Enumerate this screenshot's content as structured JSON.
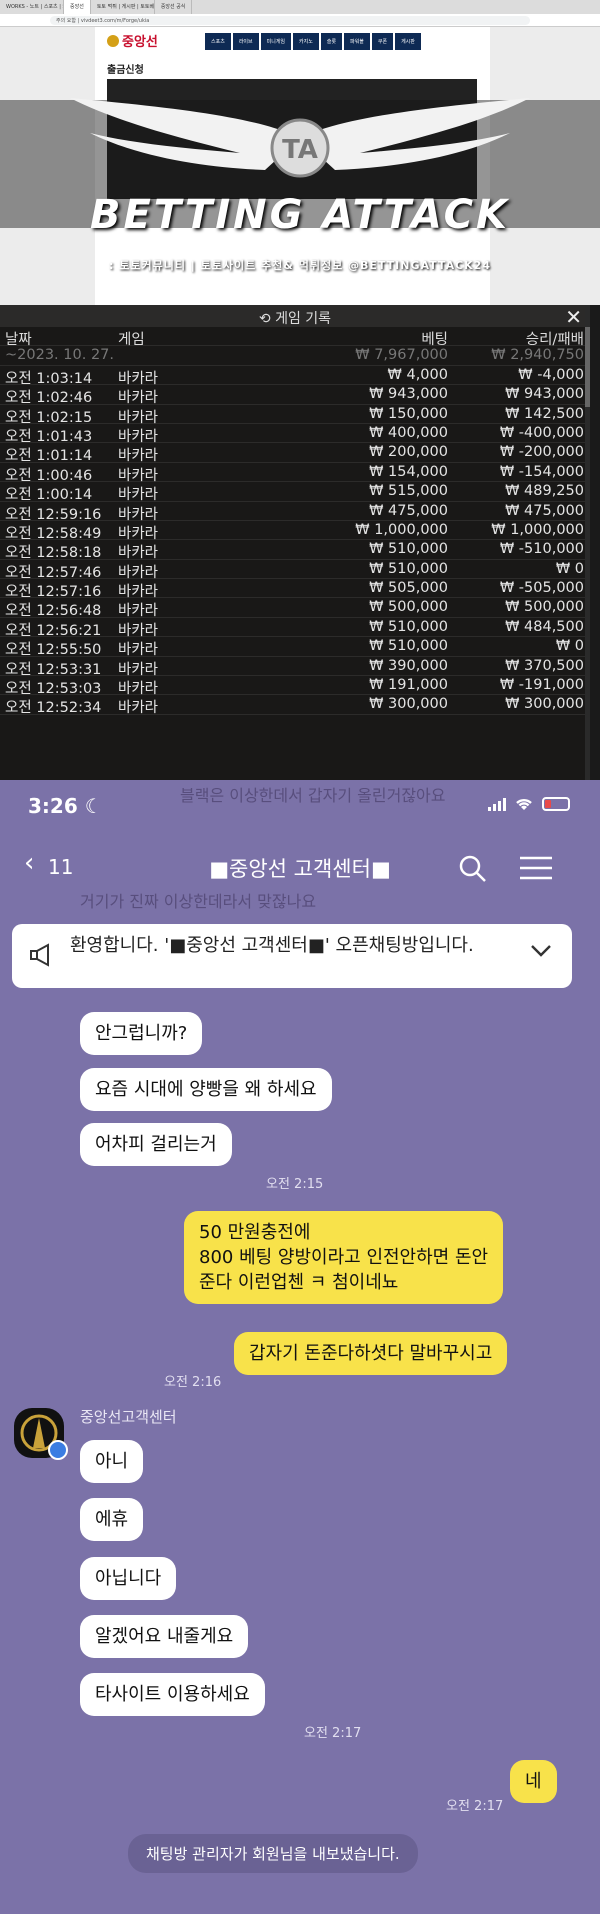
{
  "browser": {
    "tabs": [
      "WORKS - 노트 | 스포츠 | SMALL",
      "중앙선",
      "토토 먹튀 | 게시판 | 토토베팅",
      "중앙선 공식"
    ],
    "url": "주의 요함 | vivdeet3.com/m/Forge/ukia"
  },
  "site": {
    "logo": "중앙선",
    "nav": [
      "스포츠",
      "라이브",
      "미니게임",
      "카지노",
      "슬롯",
      "파워볼",
      "쿠폰",
      "게시판"
    ],
    "page_title": "출금신청"
  },
  "watermark": {
    "badge": "TA",
    "title": "BETTING ATTACK",
    "subtitle": ": 토토커뮤니티 | 토토사이트 추천& 먹튀정보 @BETTINGATTACK24"
  },
  "game_history": {
    "title": "게임 기록",
    "columns": [
      "날짜",
      "게임",
      "베팅",
      "승리/패배"
    ],
    "summary": {
      "date": "~2023. 10. 27.",
      "bet": "₩ 7,967,000",
      "win": "₩ 2,940,750"
    },
    "rows": [
      {
        "time": "오전 1:03:14",
        "game": "바카라",
        "bet": "₩ 4,000",
        "win": "₩ -4,000"
      },
      {
        "time": "오전 1:02:46",
        "game": "바카라",
        "bet": "₩ 943,000",
        "win": "₩ 943,000"
      },
      {
        "time": "오전 1:02:15",
        "game": "바카라",
        "bet": "₩ 150,000",
        "win": "₩ 142,500"
      },
      {
        "time": "오전 1:01:43",
        "game": "바카라",
        "bet": "₩ 400,000",
        "win": "₩ -400,000"
      },
      {
        "time": "오전 1:01:14",
        "game": "바카라",
        "bet": "₩ 200,000",
        "win": "₩ -200,000"
      },
      {
        "time": "오전 1:00:46",
        "game": "바카라",
        "bet": "₩ 154,000",
        "win": "₩ -154,000"
      },
      {
        "time": "오전 1:00:14",
        "game": "바카라",
        "bet": "₩ 515,000",
        "win": "₩ 489,250"
      },
      {
        "time": "오전 12:59:16",
        "game": "바카라",
        "bet": "₩ 475,000",
        "win": "₩ 475,000"
      },
      {
        "time": "오전 12:58:49",
        "game": "바카라",
        "bet": "₩ 1,000,000",
        "win": "₩ 1,000,000"
      },
      {
        "time": "오전 12:58:18",
        "game": "바카라",
        "bet": "₩ 510,000",
        "win": "₩ -510,000"
      },
      {
        "time": "오전 12:57:46",
        "game": "바카라",
        "bet": "₩ 510,000",
        "win": "₩ 0"
      },
      {
        "time": "오전 12:57:16",
        "game": "바카라",
        "bet": "₩ 505,000",
        "win": "₩ -505,000"
      },
      {
        "time": "오전 12:56:48",
        "game": "바카라",
        "bet": "₩ 500,000",
        "win": "₩ 500,000"
      },
      {
        "time": "오전 12:56:21",
        "game": "바카라",
        "bet": "₩ 510,000",
        "win": "₩ 484,500"
      },
      {
        "time": "오전 12:55:50",
        "game": "바카라",
        "bet": "₩ 510,000",
        "win": "₩ 0"
      },
      {
        "time": "오전 12:53:31",
        "game": "바카라",
        "bet": "₩ 390,000",
        "win": "₩ 370,500"
      },
      {
        "time": "오전 12:53:03",
        "game": "바카라",
        "bet": "₩ 191,000",
        "win": "₩ -191,000"
      },
      {
        "time": "오전 12:52:34",
        "game": "바카라",
        "bet": "₩ 300,000",
        "win": "₩ 300,000"
      }
    ]
  },
  "phone": {
    "time": "3:26",
    "back_count": "11",
    "chat_title": "■중앙선 고객센터■",
    "announcement": "환영합니다. '■중앙선 고객센터■' 오픈채팅방입니다.",
    "ghost_texts": [
      "블랙은 이상한데서 갑자기 올린거잖아요",
      "거기가 진짜 이상한데라서 맞잖나요"
    ],
    "sender_name": "중앙선고객센터",
    "system_message": "채팅방 관리자가 회원님을 내보냈습니다."
  },
  "messages": {
    "m1": "안그럽니까?",
    "m2": "요즘 시대에 양빵을 왜 하세요",
    "m3": "어차피 걸리는거",
    "t3": "오전 2:15",
    "m4a": "50 만원충전에",
    "m4b": "800 베팅 양방이라고 인전안하면 돈안",
    "m4c": "준다 이런업첸 ㅋ 첨이네뇨",
    "m5": "갑자기 돈준다하셧다 말바꾸시고",
    "t5": "오전 2:16",
    "m6": "아니",
    "m7": "에휴",
    "m8": "아닙니다",
    "m9": "알겠어요 내줄게요",
    "m10": "타사이트 이용하세요",
    "t10": "오전 2:17",
    "m11": "네",
    "t11": "오전 2:17"
  },
  "colors": {
    "chat_bg": "#7b72a8",
    "my_bubble": "#f8e24a",
    "history_bg": "#191817"
  }
}
